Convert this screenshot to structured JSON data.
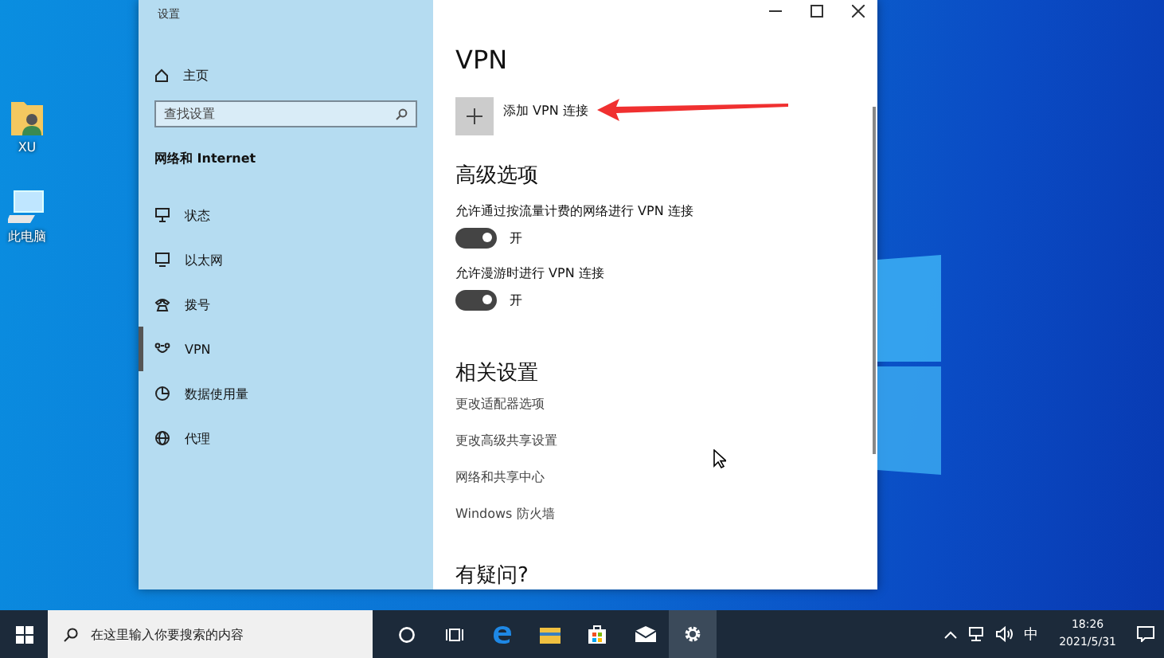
{
  "desktop_icons": [
    {
      "label": "XU",
      "kind": "user"
    },
    {
      "label": "此电脑",
      "kind": "computer"
    }
  ],
  "window": {
    "title": "设置"
  },
  "sidebar": {
    "home": "主页",
    "search": {
      "placeholder": "查找设置"
    },
    "heading": "网络和 Internet",
    "items": [
      {
        "label": "状态",
        "kind": "status",
        "selected": false
      },
      {
        "label": "以太网",
        "kind": "ethernet",
        "selected": false
      },
      {
        "label": "拨号",
        "kind": "dialup",
        "selected": false
      },
      {
        "label": "VPN",
        "kind": "vpn",
        "selected": true
      },
      {
        "label": "数据使用量",
        "kind": "data",
        "selected": false
      },
      {
        "label": "代理",
        "kind": "proxy",
        "selected": false
      }
    ]
  },
  "content": {
    "title": "VPN",
    "add_button": "添加 VPN 连接",
    "advanced_heading": "高级选项",
    "toggles": [
      {
        "label": "允许通过按流量计费的网络进行 VPN 连接",
        "on": true,
        "state": "开"
      },
      {
        "label": "允许漫游时进行 VPN 连接",
        "on": true,
        "state": "开"
      }
    ],
    "related_heading": "相关设置",
    "links": [
      "更改适配器选项",
      "更改高级共享设置",
      "网络和共享中心",
      "Windows 防火墙"
    ],
    "question_heading": "有疑问?"
  },
  "taskbar": {
    "search": {
      "placeholder": "在这里输入你要搜索的内容"
    },
    "apps": [
      {
        "kind": "cortana",
        "selected": false
      },
      {
        "kind": "taskview",
        "selected": false
      },
      {
        "kind": "edge",
        "selected": false
      },
      {
        "kind": "explorer",
        "selected": false
      },
      {
        "kind": "store",
        "selected": false
      },
      {
        "kind": "mail",
        "selected": false
      },
      {
        "kind": "settings",
        "selected": true
      }
    ],
    "ime": "中",
    "time": "18:26",
    "date": "2021/5/31"
  }
}
